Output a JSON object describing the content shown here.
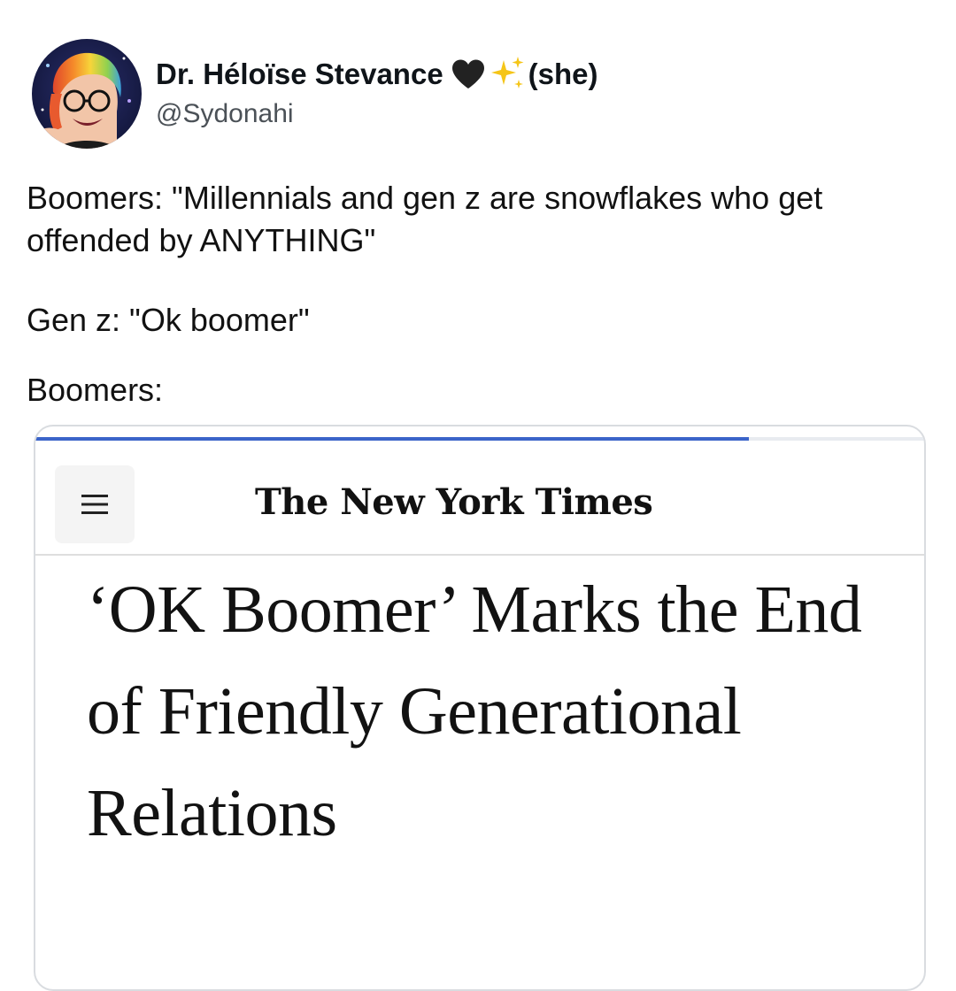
{
  "user": {
    "display_name": "Dr. Héloïse Stevance",
    "pronouns": "(she)",
    "handle": "@Sydonahi",
    "heart_emoji_icon": "black-heart-icon",
    "sparkles_emoji_icon": "sparkles-icon"
  },
  "tweet": {
    "paragraphs": [
      "Boomers: \"Millennials and gen z are snowflakes who get offended by ANYTHING\"",
      "Gen z: \"Ok boomer\"",
      "Boomers:"
    ]
  },
  "article_card": {
    "progress": 0.8,
    "menu_icon": "hamburger-menu-icon",
    "logo_text": "The New York Times",
    "headline": "‘OK Boomer’ Marks the End of Friendly Generational Relations"
  },
  "colors": {
    "progress_bar": "#3b64c9",
    "heart": "#222222",
    "sparkles": "#f5c518"
  }
}
